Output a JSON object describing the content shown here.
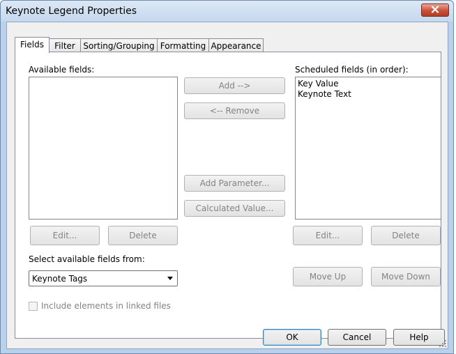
{
  "window": {
    "title": "Keynote Legend Properties",
    "close_icon": "close-icon",
    "accent_color": "#c7503a"
  },
  "tabs": [
    {
      "label": "Fields",
      "active": true
    },
    {
      "label": "Filter",
      "active": false
    },
    {
      "label": "Sorting/Grouping",
      "active": false
    },
    {
      "label": "Formatting",
      "active": false
    },
    {
      "label": "Appearance",
      "active": false
    }
  ],
  "available": {
    "label": "Available fields:",
    "items": [],
    "edit_label": "Edit...",
    "delete_label": "Delete",
    "select_from_label": "Select available fields from:",
    "select_from_value": "Keynote Tags",
    "include_linked_label": "Include elements in linked files",
    "include_linked_checked": false
  },
  "middle": {
    "add_label": "Add -->",
    "remove_label": "<-- Remove",
    "add_parameter_label": "Add Parameter...",
    "calculated_value_label": "Calculated Value..."
  },
  "scheduled": {
    "label": "Scheduled fields (in order):",
    "items": [
      "Key Value",
      "Keynote Text"
    ],
    "edit_label": "Edit...",
    "delete_label": "Delete",
    "move_up_label": "Move Up",
    "move_down_label": "Move Down"
  },
  "footer": {
    "ok_label": "OK",
    "cancel_label": "Cancel",
    "help_label": "Help"
  }
}
